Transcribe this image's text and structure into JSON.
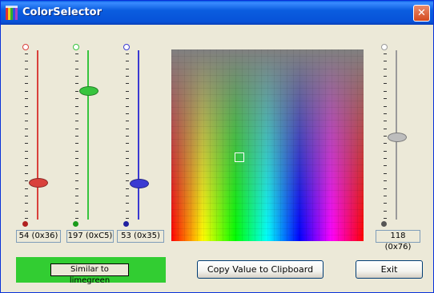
{
  "window": {
    "title": "ColorSelector",
    "close_glyph": "✕"
  },
  "colors": {
    "red": "#d9413c",
    "green": "#38c43e",
    "blue": "#3a3ad2",
    "gray": "#9a9a9a"
  },
  "sliders": [
    {
      "key": "red",
      "value": 54,
      "label": "54 (0x36)"
    },
    {
      "key": "green",
      "value": 197,
      "label": "197 (0xC5)"
    },
    {
      "key": "blue",
      "value": 53,
      "label": "53 (0x35)"
    },
    {
      "key": "gray",
      "value": 118,
      "label": "118 (0x76)"
    }
  ],
  "swatch": {
    "color": "#32cd32",
    "label": "Similar to limegreen"
  },
  "buttons": {
    "copy": "Copy Value to Clipboard",
    "exit": "Exit"
  }
}
